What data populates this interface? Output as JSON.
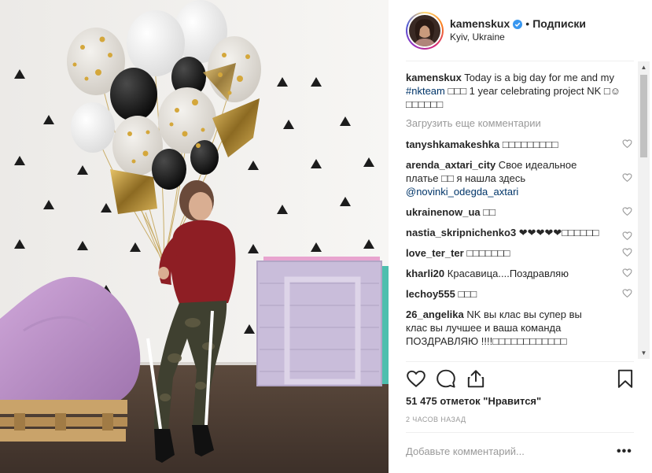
{
  "photo": {
    "alt": ""
  },
  "header": {
    "username": "kamenskux",
    "separator": "•",
    "follow_label": "Подписки",
    "location": "Kyiv, Ukraine"
  },
  "caption": {
    "username": "kamenskux",
    "text_before": " Today is a big day for me and my ",
    "hashtag": "#nkteam",
    "text_after": " □□□ 1 year celebrating project NK □☺□□□□□□"
  },
  "load_more": "Загрузить еще комментарии",
  "comments": [
    {
      "username": "tanyshkamakeshka",
      "text": " □□□□□□□□□",
      "mention": ""
    },
    {
      "username": "arenda_axtari_city",
      "text": " Свое идеальное платье □□ я нашла здесь ",
      "mention": "@novinki_odegda_axtari"
    },
    {
      "username": "ukrainenow_ua",
      "text": " □□",
      "mention": ""
    },
    {
      "username": "nastia_skripnichenko3",
      "text": " ❤❤❤❤❤□□□□□□",
      "mention": ""
    },
    {
      "username": "love_ter_ter",
      "text": " □□□□□□□",
      "mention": ""
    },
    {
      "username": "kharli20",
      "text": " Красавица....Поздравляю",
      "mention": ""
    },
    {
      "username": "lechoy555",
      "text": " □□□",
      "mention": ""
    },
    {
      "username": "26_angelika",
      "text": " NK вы клас вы супер вы клас вы лучшее и ваша команда ПОЗДРАВЛЯЮ !!!!□□□□□□□□□□□□",
      "mention": ""
    }
  ],
  "likes": "51 475 отметок \"Нравится\"",
  "time": "2 часов назад",
  "add_comment_placeholder": "Добавьте комментарий...",
  "more_options": "•••",
  "colors": {
    "link": "#003569",
    "muted": "#999999",
    "verified": "#3897f0"
  }
}
